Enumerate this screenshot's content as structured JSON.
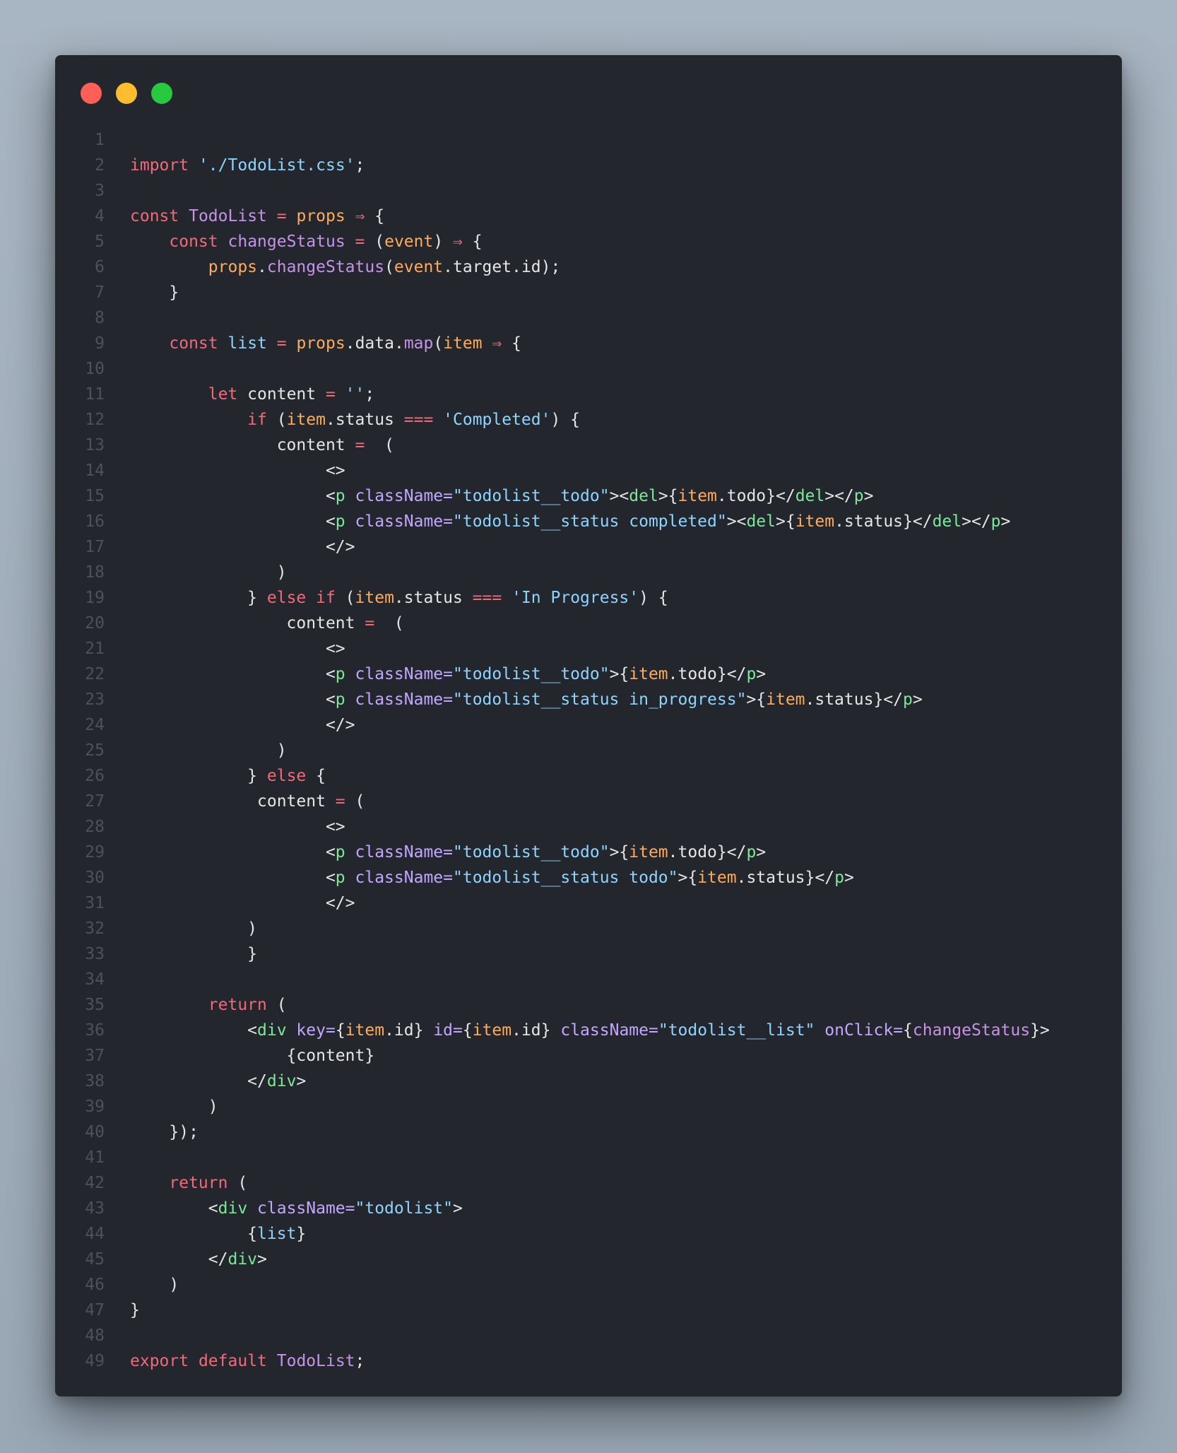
{
  "window": {
    "controls": [
      {
        "name": "close",
        "color": "#ff5f57"
      },
      {
        "name": "minimize",
        "color": "#febc2e"
      },
      {
        "name": "maximize",
        "color": "#28c840"
      }
    ]
  },
  "theme": {
    "keyword": "#f3697a",
    "func": "#c792ea",
    "string": "#8fd3ff",
    "var": "#ffab5c",
    "tag": "#7ee89a",
    "attr": "#c3a6ff",
    "text": "#e6e6e6",
    "linenum": "#4b525c"
  },
  "code": [
    [],
    [
      [
        "k",
        "import"
      ],
      [
        "t",
        " "
      ],
      [
        "s",
        "'./TodoList.css'"
      ],
      [
        "t",
        ";"
      ]
    ],
    [],
    [
      [
        "k",
        "const"
      ],
      [
        "t",
        " "
      ],
      [
        "f",
        "TodoList"
      ],
      [
        "t",
        " "
      ],
      [
        "k",
        "="
      ],
      [
        "t",
        " "
      ],
      [
        "v",
        "props"
      ],
      [
        "t",
        " "
      ],
      [
        "k",
        "⇒"
      ],
      [
        "t",
        " {"
      ]
    ],
    [
      [
        "t",
        "    "
      ],
      [
        "k",
        "const"
      ],
      [
        "t",
        " "
      ],
      [
        "f",
        "changeStatus"
      ],
      [
        "t",
        " "
      ],
      [
        "k",
        "="
      ],
      [
        "t",
        " ("
      ],
      [
        "v",
        "event"
      ],
      [
        "t",
        ") "
      ],
      [
        "k",
        "⇒"
      ],
      [
        "t",
        " {"
      ]
    ],
    [
      [
        "t",
        "        "
      ],
      [
        "v",
        "props"
      ],
      [
        "t",
        "."
      ],
      [
        "f",
        "changeStatus"
      ],
      [
        "t",
        "("
      ],
      [
        "v",
        "event"
      ],
      [
        "t",
        ".target.id);"
      ]
    ],
    [
      [
        "t",
        "    }"
      ]
    ],
    [],
    [
      [
        "t",
        "    "
      ],
      [
        "k",
        "const"
      ],
      [
        "t",
        " "
      ],
      [
        "s",
        "list"
      ],
      [
        "t",
        " "
      ],
      [
        "k",
        "="
      ],
      [
        "t",
        " "
      ],
      [
        "v",
        "props"
      ],
      [
        "t",
        ".data."
      ],
      [
        "f",
        "map"
      ],
      [
        "t",
        "("
      ],
      [
        "v",
        "item"
      ],
      [
        "t",
        " "
      ],
      [
        "k",
        "⇒"
      ],
      [
        "t",
        " {"
      ]
    ],
    [],
    [
      [
        "t",
        "        "
      ],
      [
        "k",
        "let"
      ],
      [
        "t",
        " content "
      ],
      [
        "k",
        "="
      ],
      [
        "t",
        " "
      ],
      [
        "s",
        "''"
      ],
      [
        "t",
        ";"
      ]
    ],
    [
      [
        "t",
        "            "
      ],
      [
        "k",
        "if"
      ],
      [
        "t",
        " ("
      ],
      [
        "v",
        "item"
      ],
      [
        "t",
        ".status "
      ],
      [
        "k",
        "==="
      ],
      [
        "t",
        " "
      ],
      [
        "s",
        "'Completed'"
      ],
      [
        "t",
        ") {"
      ]
    ],
    [
      [
        "t",
        "               content "
      ],
      [
        "k",
        "="
      ],
      [
        "t",
        "  ("
      ]
    ],
    [
      [
        "t",
        "                    <>"
      ]
    ],
    [
      [
        "t",
        "                    <"
      ],
      [
        "g",
        "p"
      ],
      [
        "t",
        " "
      ],
      [
        "a",
        "className="
      ],
      [
        "s",
        "\"todolist__todo\""
      ],
      [
        "t",
        "><"
      ],
      [
        "g",
        "del"
      ],
      [
        "t",
        ">{"
      ],
      [
        "v",
        "item"
      ],
      [
        "t",
        ".todo}</"
      ],
      [
        "g",
        "del"
      ],
      [
        "t",
        "></"
      ],
      [
        "g",
        "p"
      ],
      [
        "t",
        ">"
      ]
    ],
    [
      [
        "t",
        "                    <"
      ],
      [
        "g",
        "p"
      ],
      [
        "t",
        " "
      ],
      [
        "a",
        "className="
      ],
      [
        "s",
        "\"todolist__status completed\""
      ],
      [
        "t",
        "><"
      ],
      [
        "g",
        "del"
      ],
      [
        "t",
        ">{"
      ],
      [
        "v",
        "item"
      ],
      [
        "t",
        ".status}</"
      ],
      [
        "g",
        "del"
      ],
      [
        "t",
        "></"
      ],
      [
        "g",
        "p"
      ],
      [
        "t",
        ">"
      ]
    ],
    [
      [
        "t",
        "                    </>"
      ]
    ],
    [
      [
        "t",
        "               )"
      ]
    ],
    [
      [
        "t",
        "            } "
      ],
      [
        "k",
        "else"
      ],
      [
        "t",
        " "
      ],
      [
        "k",
        "if"
      ],
      [
        "t",
        " ("
      ],
      [
        "v",
        "item"
      ],
      [
        "t",
        ".status "
      ],
      [
        "k",
        "==="
      ],
      [
        "t",
        " "
      ],
      [
        "s",
        "'In Progress'"
      ],
      [
        "t",
        ") {"
      ]
    ],
    [
      [
        "t",
        "                content "
      ],
      [
        "k",
        "="
      ],
      [
        "t",
        "  ("
      ]
    ],
    [
      [
        "t",
        "                    <>"
      ]
    ],
    [
      [
        "t",
        "                    <"
      ],
      [
        "g",
        "p"
      ],
      [
        "t",
        " "
      ],
      [
        "a",
        "className="
      ],
      [
        "s",
        "\"todolist__todo\""
      ],
      [
        "t",
        ">{"
      ],
      [
        "v",
        "item"
      ],
      [
        "t",
        ".todo}</"
      ],
      [
        "g",
        "p"
      ],
      [
        "t",
        ">"
      ]
    ],
    [
      [
        "t",
        "                    <"
      ],
      [
        "g",
        "p"
      ],
      [
        "t",
        " "
      ],
      [
        "a",
        "className="
      ],
      [
        "s",
        "\"todolist__status in_progress\""
      ],
      [
        "t",
        ">{"
      ],
      [
        "v",
        "item"
      ],
      [
        "t",
        ".status}</"
      ],
      [
        "g",
        "p"
      ],
      [
        "t",
        ">"
      ]
    ],
    [
      [
        "t",
        "                    </>"
      ]
    ],
    [
      [
        "t",
        "               )"
      ]
    ],
    [
      [
        "t",
        "            } "
      ],
      [
        "k",
        "else"
      ],
      [
        "t",
        " {"
      ]
    ],
    [
      [
        "t",
        "             content "
      ],
      [
        "k",
        "="
      ],
      [
        "t",
        " ("
      ]
    ],
    [
      [
        "t",
        "                    <>"
      ]
    ],
    [
      [
        "t",
        "                    <"
      ],
      [
        "g",
        "p"
      ],
      [
        "t",
        " "
      ],
      [
        "a",
        "className="
      ],
      [
        "s",
        "\"todolist__todo\""
      ],
      [
        "t",
        ">{"
      ],
      [
        "v",
        "item"
      ],
      [
        "t",
        ".todo}</"
      ],
      [
        "g",
        "p"
      ],
      [
        "t",
        ">"
      ]
    ],
    [
      [
        "t",
        "                    <"
      ],
      [
        "g",
        "p"
      ],
      [
        "t",
        " "
      ],
      [
        "a",
        "className="
      ],
      [
        "s",
        "\"todolist__status todo\""
      ],
      [
        "t",
        ">{"
      ],
      [
        "v",
        "item"
      ],
      [
        "t",
        ".status}</"
      ],
      [
        "g",
        "p"
      ],
      [
        "t",
        ">"
      ]
    ],
    [
      [
        "t",
        "                    </>"
      ]
    ],
    [
      [
        "t",
        "            )"
      ]
    ],
    [
      [
        "t",
        "            }"
      ]
    ],
    [],
    [
      [
        "t",
        "        "
      ],
      [
        "k",
        "return"
      ],
      [
        "t",
        " ("
      ]
    ],
    [
      [
        "t",
        "            <"
      ],
      [
        "g",
        "div"
      ],
      [
        "t",
        " "
      ],
      [
        "a",
        "key="
      ],
      [
        "t",
        "{"
      ],
      [
        "v",
        "item"
      ],
      [
        "t",
        ".id} "
      ],
      [
        "a",
        "id="
      ],
      [
        "t",
        "{"
      ],
      [
        "v",
        "item"
      ],
      [
        "t",
        ".id} "
      ],
      [
        "a",
        "className="
      ],
      [
        "s",
        "\"todolist__list\""
      ],
      [
        "t",
        " "
      ],
      [
        "a",
        "onClick="
      ],
      [
        "t",
        "{"
      ],
      [
        "f",
        "changeStatus"
      ],
      [
        "t",
        "}>"
      ]
    ],
    [
      [
        "t",
        "                {content}"
      ]
    ],
    [
      [
        "t",
        "            </"
      ],
      [
        "g",
        "div"
      ],
      [
        "t",
        ">"
      ]
    ],
    [
      [
        "t",
        "        )"
      ]
    ],
    [
      [
        "t",
        "    });"
      ]
    ],
    [],
    [
      [
        "t",
        "    "
      ],
      [
        "k",
        "return"
      ],
      [
        "t",
        " ("
      ]
    ],
    [
      [
        "t",
        "        <"
      ],
      [
        "g",
        "div"
      ],
      [
        "t",
        " "
      ],
      [
        "a",
        "className="
      ],
      [
        "s",
        "\"todolist\""
      ],
      [
        "t",
        ">"
      ]
    ],
    [
      [
        "t",
        "            {"
      ],
      [
        "s",
        "list"
      ],
      [
        "t",
        "}"
      ]
    ],
    [
      [
        "t",
        "        </"
      ],
      [
        "g",
        "div"
      ],
      [
        "t",
        ">"
      ]
    ],
    [
      [
        "t",
        "    )"
      ]
    ],
    [
      [
        "t",
        "}"
      ]
    ],
    [],
    [
      [
        "k",
        "export"
      ],
      [
        "t",
        " "
      ],
      [
        "k",
        "default"
      ],
      [
        "t",
        " "
      ],
      [
        "f",
        "TodoList"
      ],
      [
        "t",
        ";"
      ]
    ]
  ]
}
